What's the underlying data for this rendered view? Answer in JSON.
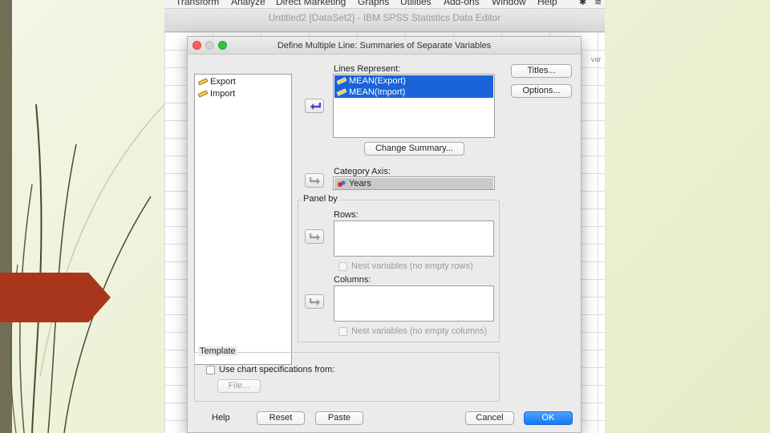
{
  "app": {
    "menu": [
      "Transform",
      "Analyze",
      "Direct Marketing",
      "Graphs",
      "Utilities",
      "Add-ons",
      "Window",
      "Help"
    ],
    "window_title": "Untitled2 [DataSet2] - IBM SPSS Statistics Data Editor",
    "var_label": "var"
  },
  "dialog": {
    "title": "Define Multiple Line: Summaries of Separate Variables",
    "source_vars": [
      {
        "label": "Export",
        "icon": "scale-ruler-icon"
      },
      {
        "label": "Import",
        "icon": "scale-ruler-icon"
      }
    ],
    "lines_represent": {
      "label": "Lines Represent:",
      "items": [
        "MEAN(Export)",
        "MEAN(Import)"
      ]
    },
    "change_summary_label": "Change Summary...",
    "category_axis": {
      "label": "Category Axis:",
      "value": "Years"
    },
    "panel_by": {
      "title": "Panel by",
      "rows_label": "Rows:",
      "nest_rows_label": "Nest variables (no empty rows)",
      "columns_label": "Columns:",
      "nest_columns_label": "Nest variables (no empty columns)"
    },
    "template": {
      "title": "Template",
      "use_spec_label": "Use chart specifications from:",
      "file_label": "File..."
    },
    "side_buttons": {
      "titles": "Titles...",
      "options": "Options..."
    },
    "footer": {
      "help": "Help",
      "reset": "Reset",
      "paste": "Paste",
      "cancel": "Cancel",
      "ok": "OK"
    }
  },
  "colors": {
    "selection": "#1a63d8",
    "ok_button": "#1878f0",
    "slide_bar": "#716e55",
    "slide_arrow": "#a8361c"
  }
}
